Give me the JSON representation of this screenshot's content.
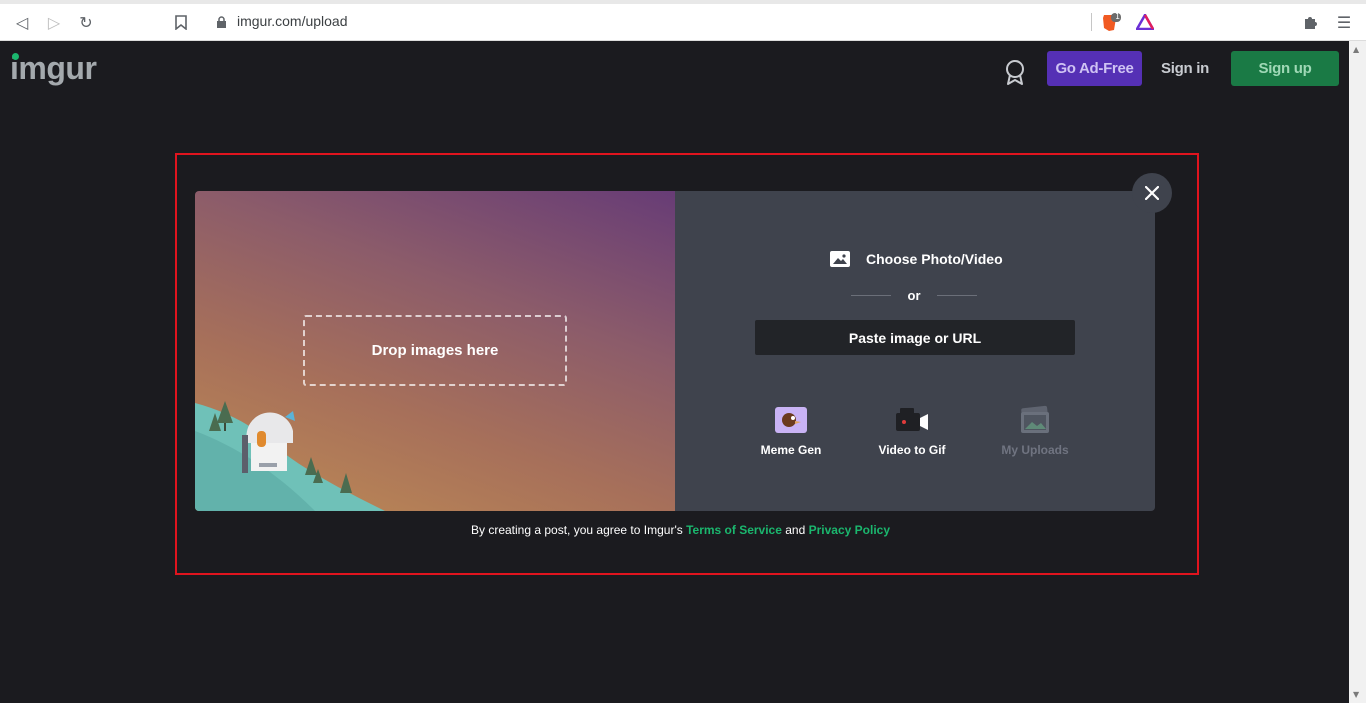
{
  "browser": {
    "url": "imgur.com/upload",
    "tabs_badge": "17"
  },
  "header": {
    "logo": "imgur",
    "ad_free_label": "Go Ad-Free",
    "sign_in_label": "Sign in",
    "sign_up_label": "Sign up"
  },
  "upload": {
    "drop_label": "Drop images here",
    "choose_label": "Choose Photo/Video",
    "or_label": "or",
    "paste_label": "Paste image or URL",
    "tools": [
      {
        "label": "Meme Gen",
        "icon": "meme-gen-icon"
      },
      {
        "label": "Video to Gif",
        "icon": "video-camera-icon"
      },
      {
        "label": "My Uploads",
        "icon": "my-uploads-icon"
      }
    ]
  },
  "terms": {
    "prefix": "By creating a post, you agree to Imgur's",
    "tos": "Terms of Service",
    "and": "and",
    "privacy": "Privacy Policy"
  },
  "colors": {
    "background": "#1b1b1f",
    "ad_free": "#5530b5",
    "sign_up": "#1a7a45",
    "link": "#1bb76e",
    "highlight": "#e0141e"
  }
}
